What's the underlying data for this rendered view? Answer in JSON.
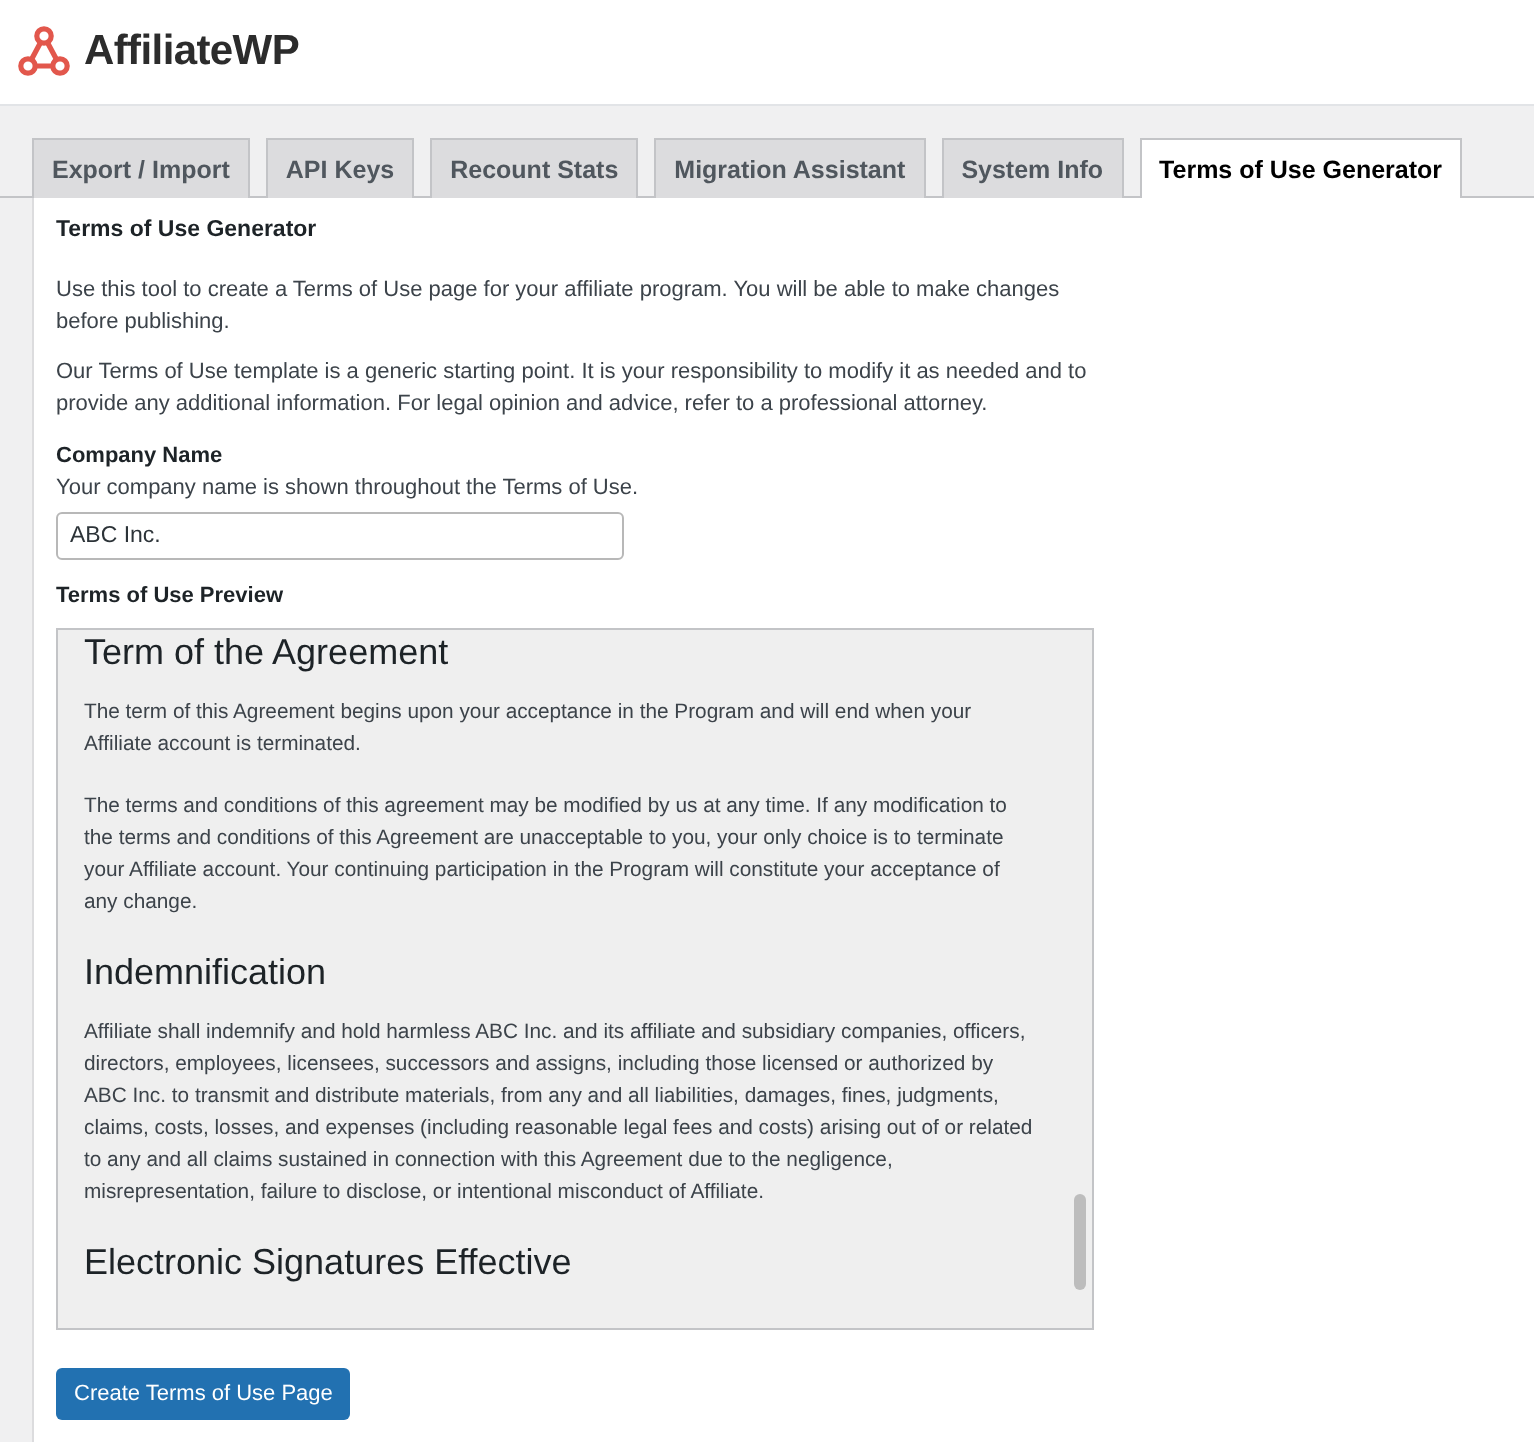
{
  "brand": {
    "name": "AffiliateWP"
  },
  "tabs": [
    {
      "label": "Export / Import",
      "selected": false
    },
    {
      "label": "API Keys",
      "selected": false
    },
    {
      "label": "Recount Stats",
      "selected": false
    },
    {
      "label": "Migration Assistant",
      "selected": false
    },
    {
      "label": "System Info",
      "selected": false
    },
    {
      "label": "Terms of Use Generator",
      "selected": true
    }
  ],
  "section_title": "Terms of Use Generator",
  "intro": [
    "Use this tool to create a Terms of Use page for your affiliate program. You will be able to make changes before publishing.",
    "Our Terms of Use template is a generic starting point. It is your responsibility to modify it as needed and to provide any additional information. For legal opinion and advice, refer to a professional attorney."
  ],
  "company_field": {
    "label": "Company Name",
    "help": "Your company name is shown throughout the Terms of Use.",
    "value": "ABC Inc."
  },
  "preview": {
    "label": "Terms of Use Preview",
    "blocks": [
      {
        "kind": "heading",
        "text": "Term of the Agreement"
      },
      {
        "kind": "paragraph",
        "text": "The term of this Agreement begins upon your acceptance in the Program and will end when your Affiliate account is terminated."
      },
      {
        "kind": "paragraph",
        "text": "The terms and conditions of this agreement may be modified by us at any time. If any modification to the terms and conditions of this Agreement are unacceptable to you, your only choice is to terminate your Affiliate account. Your continuing participation in the Program will constitute your acceptance of any change."
      },
      {
        "kind": "heading",
        "text": "Indemnification"
      },
      {
        "kind": "paragraph",
        "text": "Affiliate shall indemnify and hold harmless ABC Inc. and its affiliate and subsidiary companies, officers, directors, employees, licensees, successors and assigns, including those licensed or authorized by ABC Inc. to transmit and distribute materials, from any and all liabilities, damages, fines, judgments, claims, costs, losses, and expenses (including reasonable legal fees and costs) arising out of or related to any and all claims sustained in connection with this Agreement due to the negligence, misrepresentation, failure to disclose, or intentional misconduct of Affiliate."
      },
      {
        "kind": "heading",
        "text": "Electronic Signatures Effective"
      }
    ]
  },
  "submit_button": "Create Terms of Use Page"
}
